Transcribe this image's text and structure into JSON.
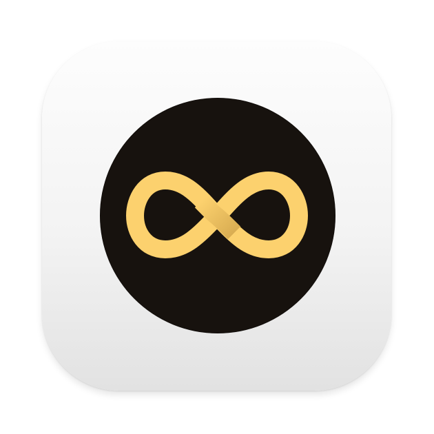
{
  "app_icon": {
    "name": "infinity-app-icon",
    "tile_color": "#f4f4f4",
    "disc_color": "#17120e",
    "symbol": "infinity-icon",
    "symbol_color": "#fcd16e",
    "symbol_shade": "#d9ad52"
  }
}
